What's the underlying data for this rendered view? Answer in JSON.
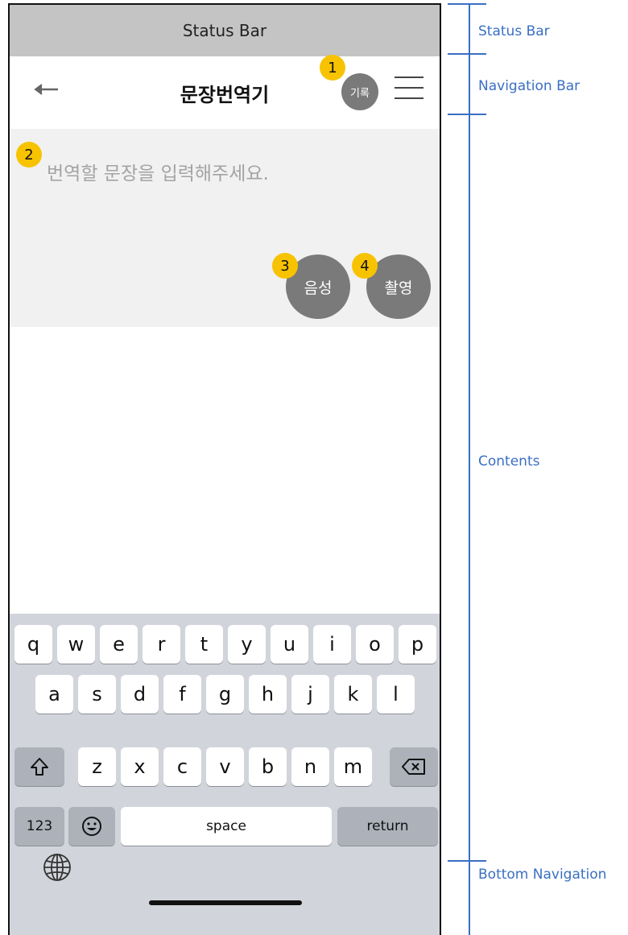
{
  "status_bar": {
    "label": "Status Bar"
  },
  "nav_bar": {
    "title": "문장번역기",
    "history_label": "기록",
    "back_icon": "arrow-left-icon",
    "menu_icon": "hamburger-menu-icon"
  },
  "input": {
    "placeholder": "번역할 문장을 입력해주세요.",
    "value": ""
  },
  "buttons": {
    "voice_label": "음성",
    "camera_label": "촬영"
  },
  "badges": [
    "1",
    "2",
    "3",
    "4"
  ],
  "keyboard": {
    "row1": [
      "q",
      "w",
      "e",
      "r",
      "t",
      "y",
      "u",
      "i",
      "o",
      "p"
    ],
    "row2": [
      "a",
      "s",
      "d",
      "f",
      "g",
      "h",
      "j",
      "k",
      "l"
    ],
    "row3": [
      "z",
      "x",
      "c",
      "v",
      "b",
      "n",
      "m"
    ],
    "numbers_label": "123",
    "space_label": "space",
    "return_label": "return"
  },
  "annotations": {
    "status_bar": "Status Bar",
    "navigation_bar": "Navigation Bar",
    "contents": "Contents",
    "bottom_navigation": "Bottom Navigation"
  },
  "colors": {
    "badge": "#f7c300",
    "button": "#7a7a7a",
    "annotation": "#3a6fc4",
    "status_bar": "#c4c4c4",
    "input_bg": "#f1f1f1",
    "keyboard_bg": "#d1d4db"
  }
}
